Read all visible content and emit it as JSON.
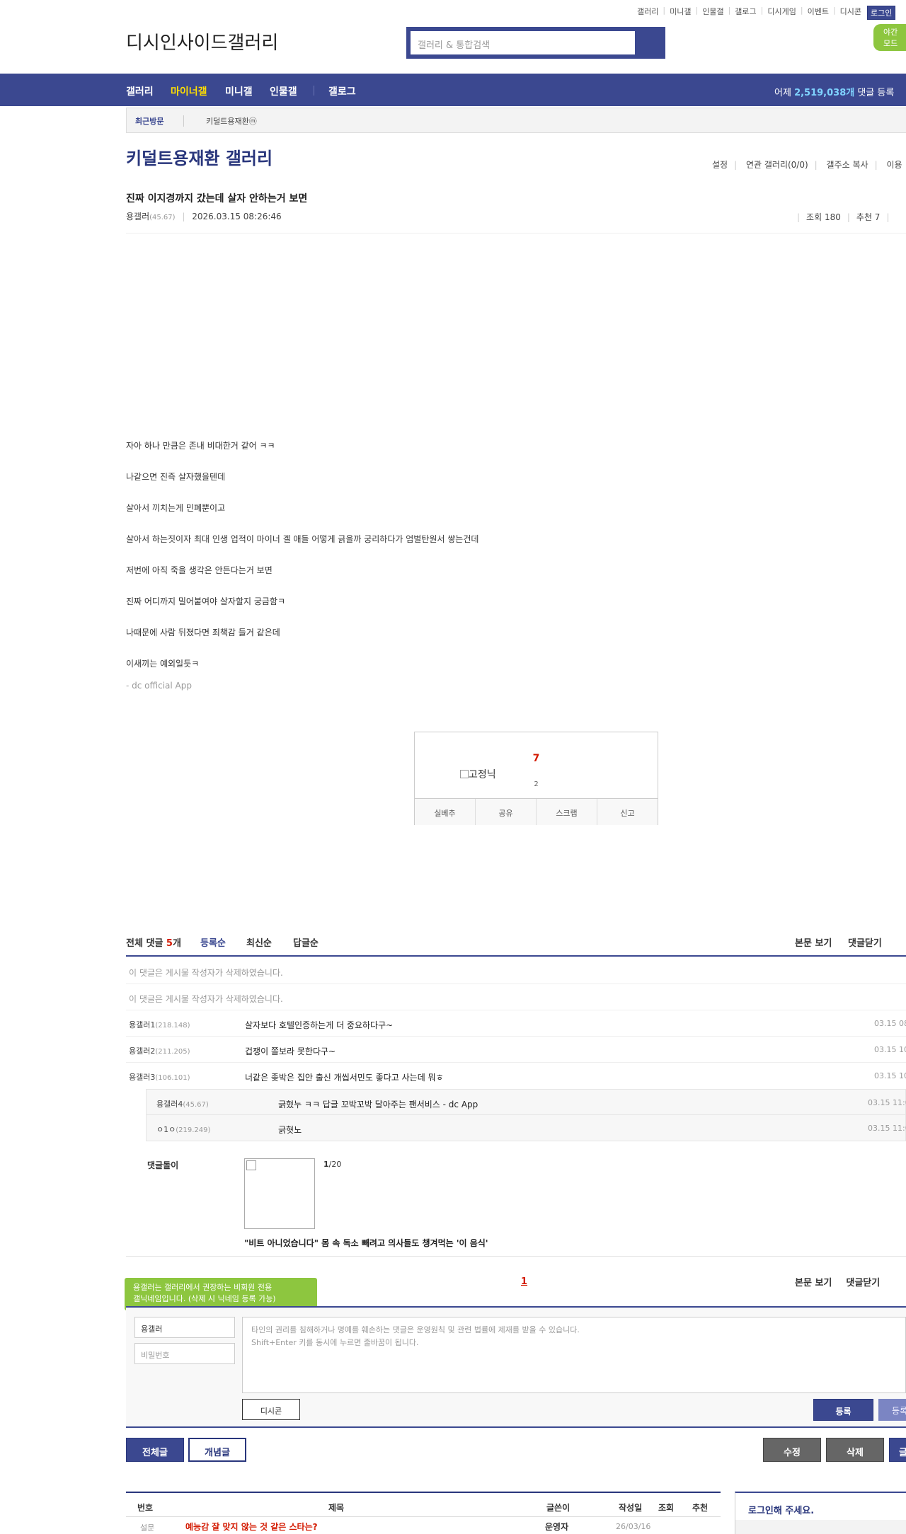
{
  "topnav": {
    "links": [
      "갤러리",
      "미니갤",
      "인물갤",
      "갤로그",
      "디시게임",
      "이벤트",
      "디시콘"
    ],
    "login": "로그인",
    "night": "야간 모드"
  },
  "logo": {
    "alt_text": "디시인사이드갤러리"
  },
  "search": {
    "placeholder": "갤러리 & 통합검색"
  },
  "gnb": {
    "items": [
      "갤러리",
      "마이너갤",
      "미니갤",
      "인물갤",
      "갤로그"
    ],
    "stat_prefix": "어제 ",
    "stat_value": "2,519,038개",
    "stat_suffix": " 댓글 등록"
  },
  "recent": {
    "label": "최근방문",
    "gallery": "키덜트용재환ⓜ"
  },
  "gallery": {
    "title": "키덜트용재환 갤러리",
    "menu": [
      "설정",
      "연관 갤러리(0/0)",
      "갤주소 복사",
      "이용"
    ]
  },
  "post": {
    "title": "진짜 이지경까지 갔는데 살자 안하는거 보면",
    "author": "용갤러",
    "author_ip": "(45.67)",
    "date": "2026.03.15 08:26:46",
    "views": "조회 180",
    "recommends": "추천 7",
    "lines": [
      "자아 하나 만큼은 존내 비대한거 같어 ㅋㅋ",
      "나같으면 진즉 살자했을텐데",
      "살아서 끼치는게 민폐뿐이고",
      "살아서 하는짓이자 최대 인생 업적이 마이너 겔 애들 어떻게 긁을까 궁리하다가 엄벌탄원서 쌓는건데",
      "저번에 아직 죽을 생각은 안든다는거 보면",
      "진짜 어디까지 밀어붙여야 살자할지 궁금함ㅋ",
      "나때문에 사람 뒤졌다면 죄책감 들거 같은데",
      "이새끼는 예외일듯ㅋ"
    ],
    "app_tag": "- dc official App"
  },
  "recommend": {
    "count": "7",
    "fixed_alt": "고정닉",
    "fixed_count": "2",
    "buttons": [
      "실베추",
      "공유",
      "스크랩",
      "신고"
    ]
  },
  "comments": {
    "header_prefix": "전체 댓글 ",
    "count": "5",
    "header_suffix": "개",
    "sorts": [
      "등록순",
      "최신순",
      "답글순"
    ],
    "tools": [
      "본문 보기",
      "댓글닫기"
    ],
    "deleted": [
      "이 댓글은 게시물 작성자가 삭제하였습니다.",
      "이 댓글은 게시물 작성자가 삭제하였습니다."
    ],
    "items": [
      {
        "nick": "용갤러1",
        "ip": "(218.148)",
        "text": "살자보다 호텔인증하는게 더 중요하다구~",
        "date": "03.15 08"
      },
      {
        "nick": "용갤러2",
        "ip": "(211.205)",
        "text": "겁쟁이 쫄보라 못한다구~",
        "date": "03.15 10"
      },
      {
        "nick": "용갤러3",
        "ip": "(106.101)",
        "text": "너같은 좆박은 집안 출신 개씹서민도 좋다고 사는데 뭐ㅎ",
        "date": "03.15 10"
      }
    ],
    "replies": [
      {
        "nick": "용갤러4",
        "ip": "(45.67)",
        "text": "긁혔누 ㅋㅋ 답글 꼬박꼬박 달아주는 팬서비스 - dc App",
        "date": "03.15 11:0"
      },
      {
        "nick": "ㅇ1ㅇ",
        "ip": "(219.249)",
        "text": "긁혓노",
        "date": "03.15 11:0"
      }
    ]
  },
  "dol": {
    "label": "댓글돌이",
    "page_current": "1",
    "page_total": "/20",
    "caption": "\"비트 아니었습니다\" 몸 속 독소 빼려고 의사들도 챙겨먹는 '이 음식'"
  },
  "tip": {
    "line1": "용갤러는 갤러리에서 권장하는 비회원 전용",
    "line2": "갤닉네임입니다. (삭제 시 닉네임 등록 가능)"
  },
  "pager": {
    "current": "1"
  },
  "write": {
    "nick": "용갤러",
    "pw_placeholder": "비밀번호",
    "ta_line1": "타인의 권리를 침해하거나 명예를 훼손하는 댓글은 운영원칙 및 관련 법률에 제재를 받을 수 있습니다.",
    "ta_line2": "Shift+Enter 키를 동시에 누르면 줄바꿈이 됩니다.",
    "dccon": "디시콘",
    "register": "등록",
    "register2": "등록"
  },
  "actions": {
    "all": "전체글",
    "concept": "개념글",
    "edit": "수정",
    "delete": "삭제",
    "write": "글"
  },
  "list": {
    "headers": [
      "번호",
      "제목",
      "글쓴이",
      "작성일",
      "조회",
      "추천"
    ],
    "first_row": {
      "no": "설문",
      "title": "예능감 잘 맞지 않는 것 같은 스타는?",
      "writer": "운영자",
      "date": "26/03/16"
    }
  },
  "loginbox": {
    "title": "로그인해 주세요."
  },
  "colors": {
    "brand": "#3b4890",
    "accent_yellow": "#ffde00",
    "alert_red": "#d31900",
    "tip_green": "#8dc63f"
  }
}
